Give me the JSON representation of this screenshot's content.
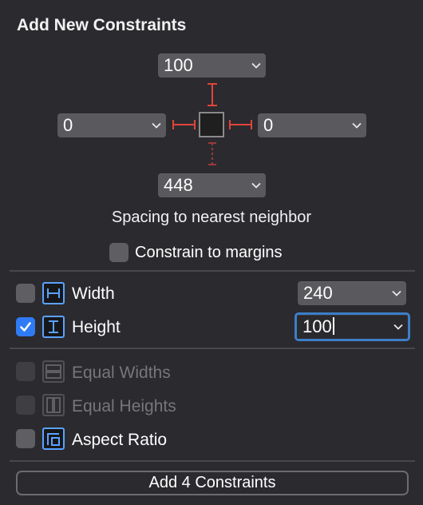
{
  "panel": {
    "title": "Add New Constraints",
    "caption": "Spacing to nearest neighbor",
    "constrain_to_margins_label": "Constrain to margins"
  },
  "spacing": {
    "top": "100",
    "left": "0",
    "right": "0",
    "bottom": "448"
  },
  "size": {
    "width_label": "Width",
    "width_value": "240",
    "width_checked": false,
    "height_label": "Height",
    "height_value": "100",
    "height_checked": true
  },
  "options": {
    "equal_widths": "Equal Widths",
    "equal_heights": "Equal Heights",
    "aspect_ratio": "Aspect Ratio"
  },
  "action": {
    "add_label": "Add 4 Constraints"
  },
  "colors": {
    "accent": "#2f7bf5",
    "constraint_red": "#e2443a",
    "icon_blue": "#5aa2ff"
  }
}
